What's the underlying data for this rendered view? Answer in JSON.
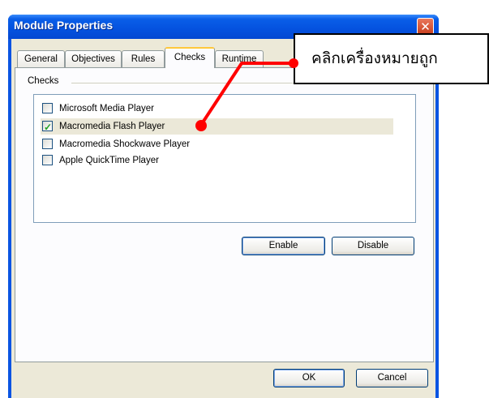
{
  "window": {
    "title": "Module Properties",
    "close_symbol": "✕"
  },
  "tabs": [
    {
      "label": "General"
    },
    {
      "label": "Objectives"
    },
    {
      "label": "Rules"
    },
    {
      "label": "Checks"
    },
    {
      "label": "Runtime"
    }
  ],
  "checks_group": {
    "label": "Checks",
    "items": [
      {
        "label": "Microsoft Media Player",
        "checked": false
      },
      {
        "label": "Macromedia Flash Player",
        "checked": true
      },
      {
        "label": "Macromedia Shockwave Player",
        "checked": false
      },
      {
        "label": "Apple QuickTime Player",
        "checked": false
      }
    ]
  },
  "buttons": {
    "enable": "Enable",
    "disable": "Disable",
    "ok": "OK",
    "cancel": "Cancel"
  },
  "callout": {
    "text": "คลิกเครื่องหมายถูก",
    "pointer_color": "#ff0000"
  },
  "colors": {
    "title_blue": "#0553e0",
    "face": "#ece9d8",
    "check_green": "#21a121"
  }
}
